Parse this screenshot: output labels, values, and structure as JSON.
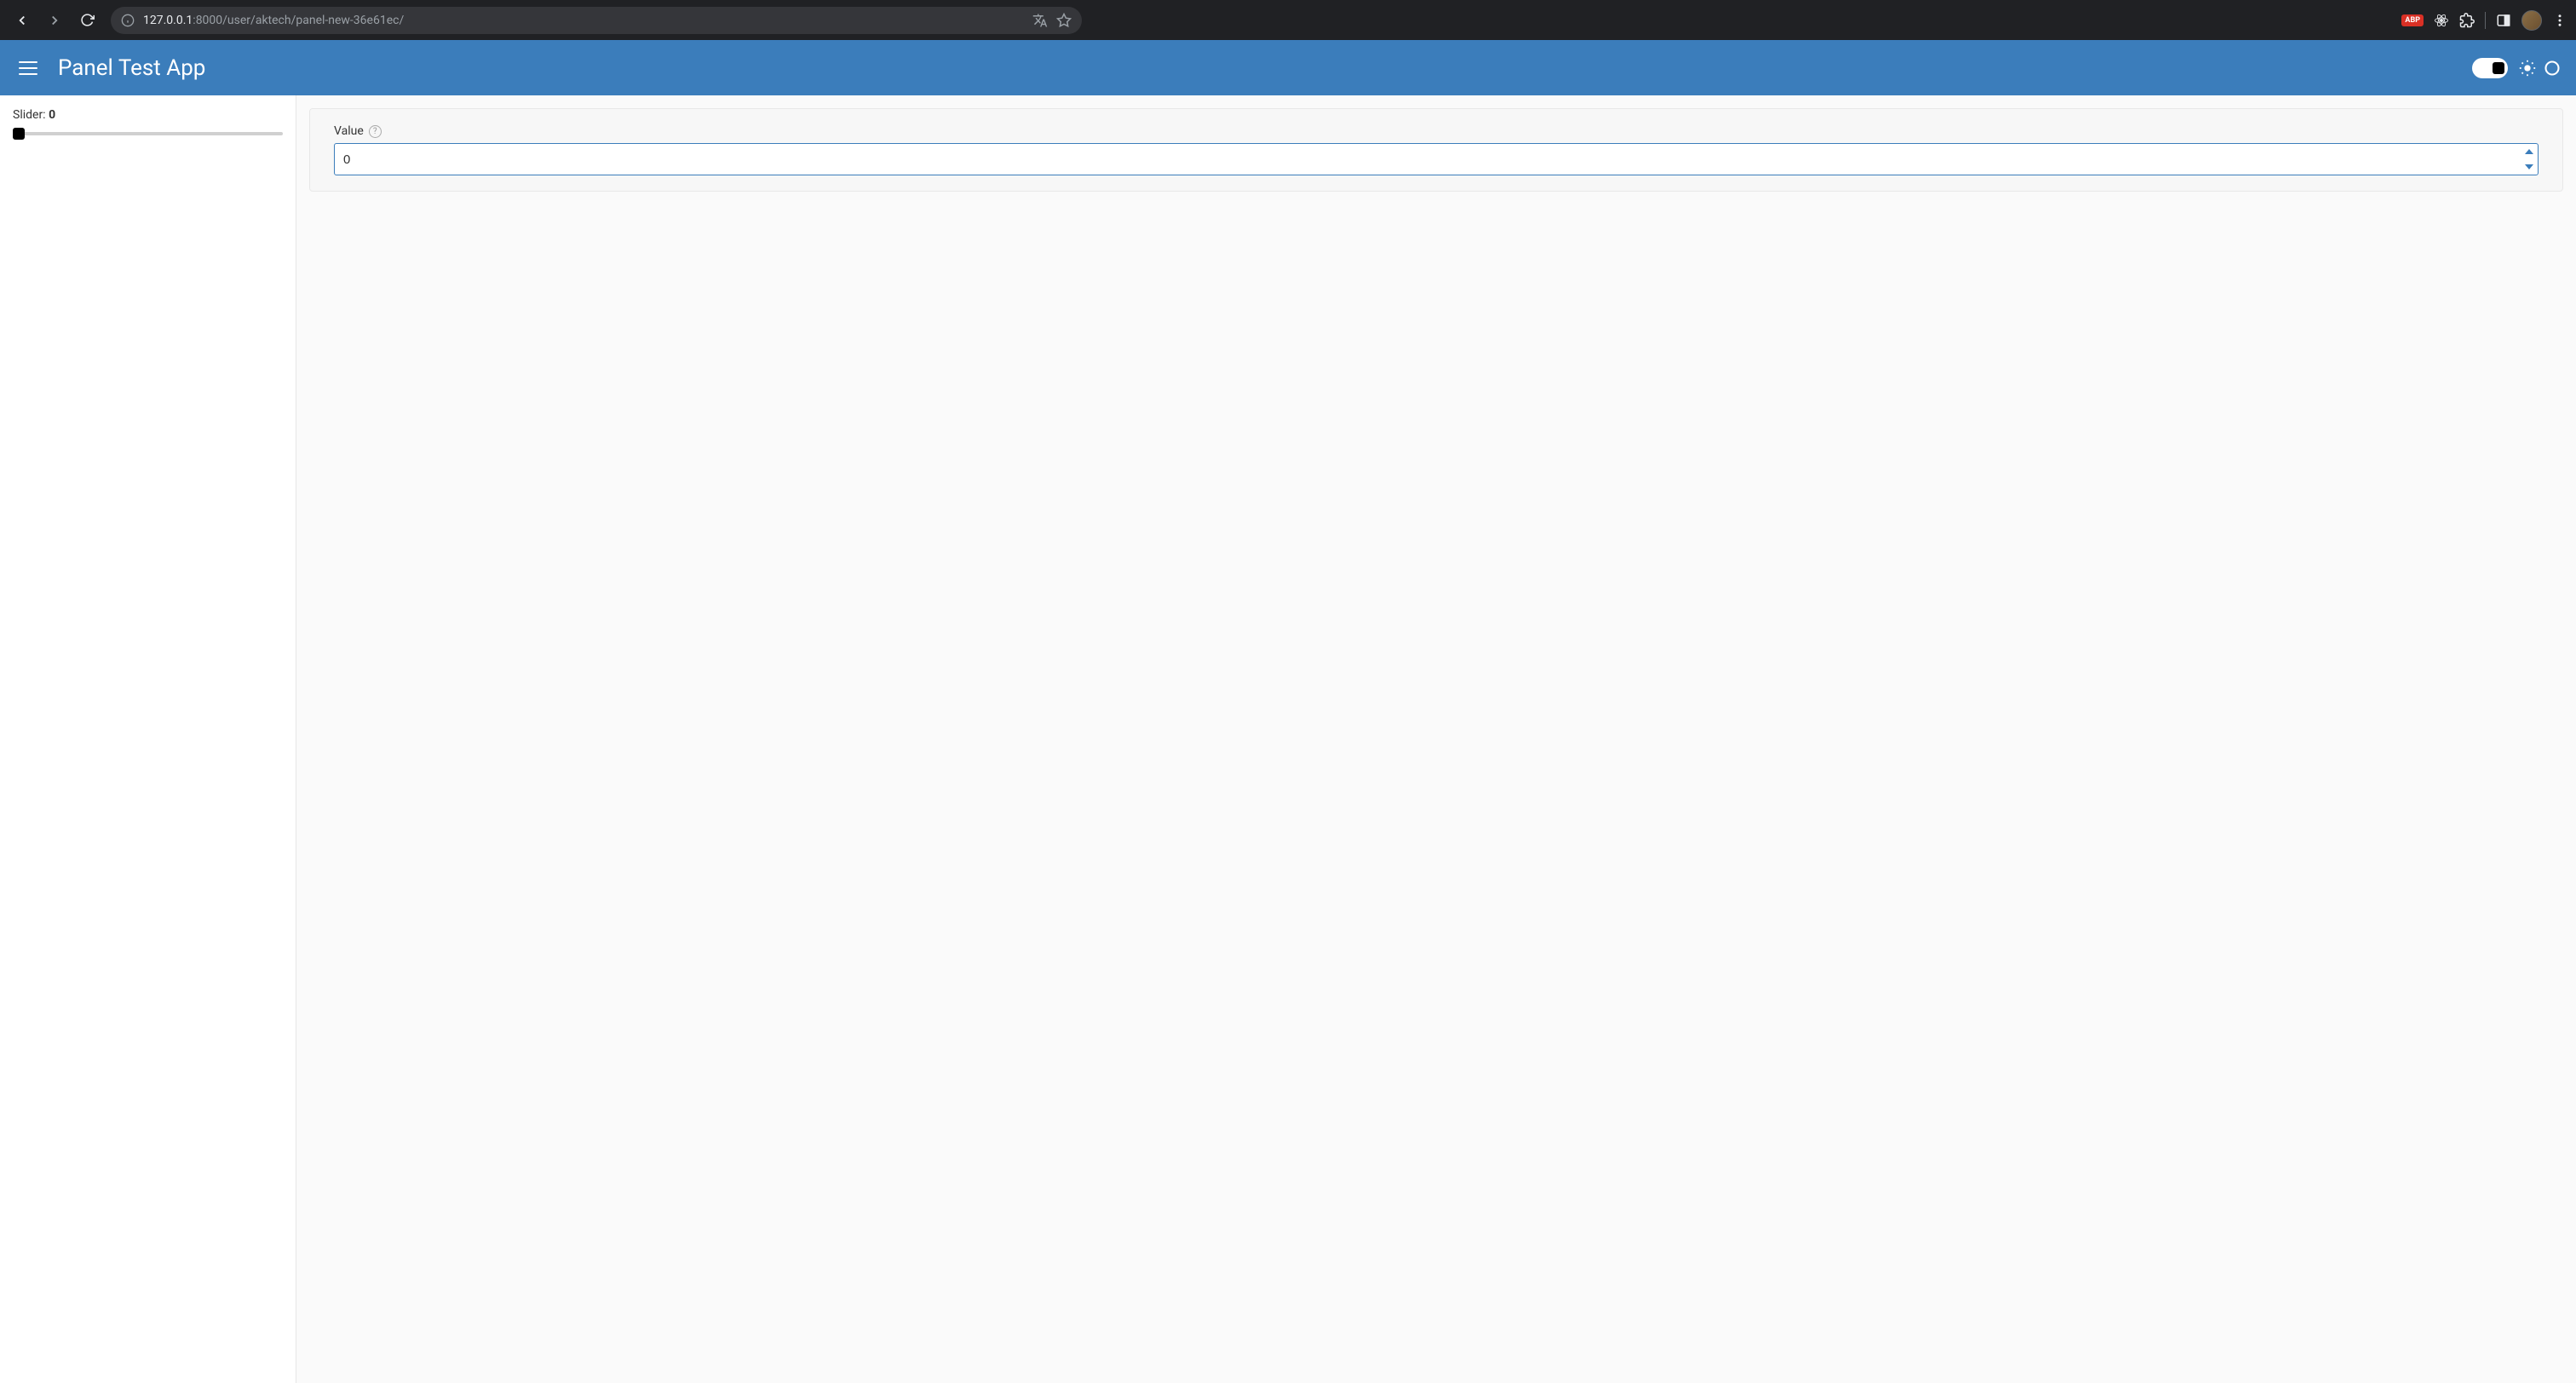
{
  "browser": {
    "url_host": "127.0.0.1",
    "url_path": ":8000/user/aktech/panel-new-36e61ec/",
    "abp_label": "ABP"
  },
  "header": {
    "title": "Panel Test App"
  },
  "sidebar": {
    "slider_label": "Slider: ",
    "slider_value": "0"
  },
  "main": {
    "value_label": "Value",
    "value": "0"
  }
}
